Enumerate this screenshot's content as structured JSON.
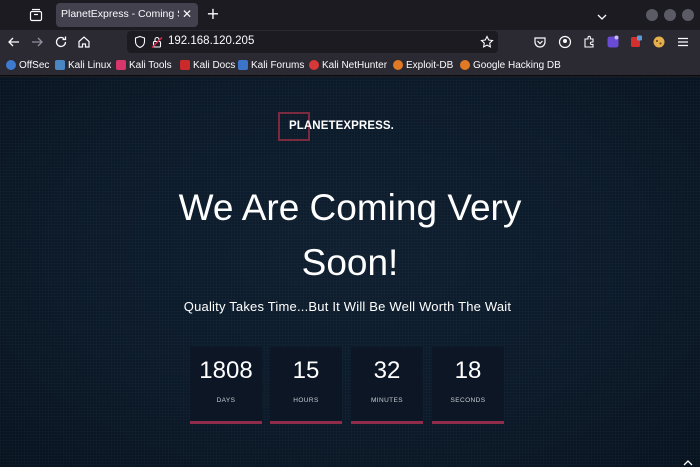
{
  "browser": {
    "tab": {
      "title": "PlanetExpress - Coming Soon",
      "close_label": "✕"
    },
    "new_tab_label": "+",
    "url": "192.168.120.205",
    "bookmarks": [
      {
        "label": "OffSec",
        "icon": "offsec-icon",
        "color": "#3d7bd1"
      },
      {
        "label": "Kali Linux",
        "icon": "kali-linux-icon",
        "color": "#4b86c4"
      },
      {
        "label": "Kali Tools",
        "icon": "kali-tools-icon",
        "color": "#d6366b"
      },
      {
        "label": "Kali Docs",
        "icon": "kali-docs-icon",
        "color": "#cc2a2a"
      },
      {
        "label": "Kali Forums",
        "icon": "kali-forums-icon",
        "color": "#3b74c9"
      },
      {
        "label": "Kali NetHunter",
        "icon": "kali-nethunter-icon",
        "color": "#d83838"
      },
      {
        "label": "Exploit-DB",
        "icon": "exploit-db-icon",
        "color": "#e07a24"
      },
      {
        "label": "Google Hacking DB",
        "icon": "google-hacking-db-icon",
        "color": "#e07a24"
      }
    ]
  },
  "page": {
    "logo": "PLANETEXPRESS.",
    "headline_line1": "We Are Coming Very",
    "headline_line2": "Soon!",
    "subheadline": "Quality Takes Time...But It Will Be Well Worth The Wait",
    "countdown": [
      {
        "value": "1808",
        "label": "DAYS"
      },
      {
        "value": "15",
        "label": "HOURS"
      },
      {
        "value": "32",
        "label": "MINUTES"
      },
      {
        "value": "18",
        "label": "SECONDS"
      }
    ],
    "accent_color": "#8e2c4a"
  }
}
